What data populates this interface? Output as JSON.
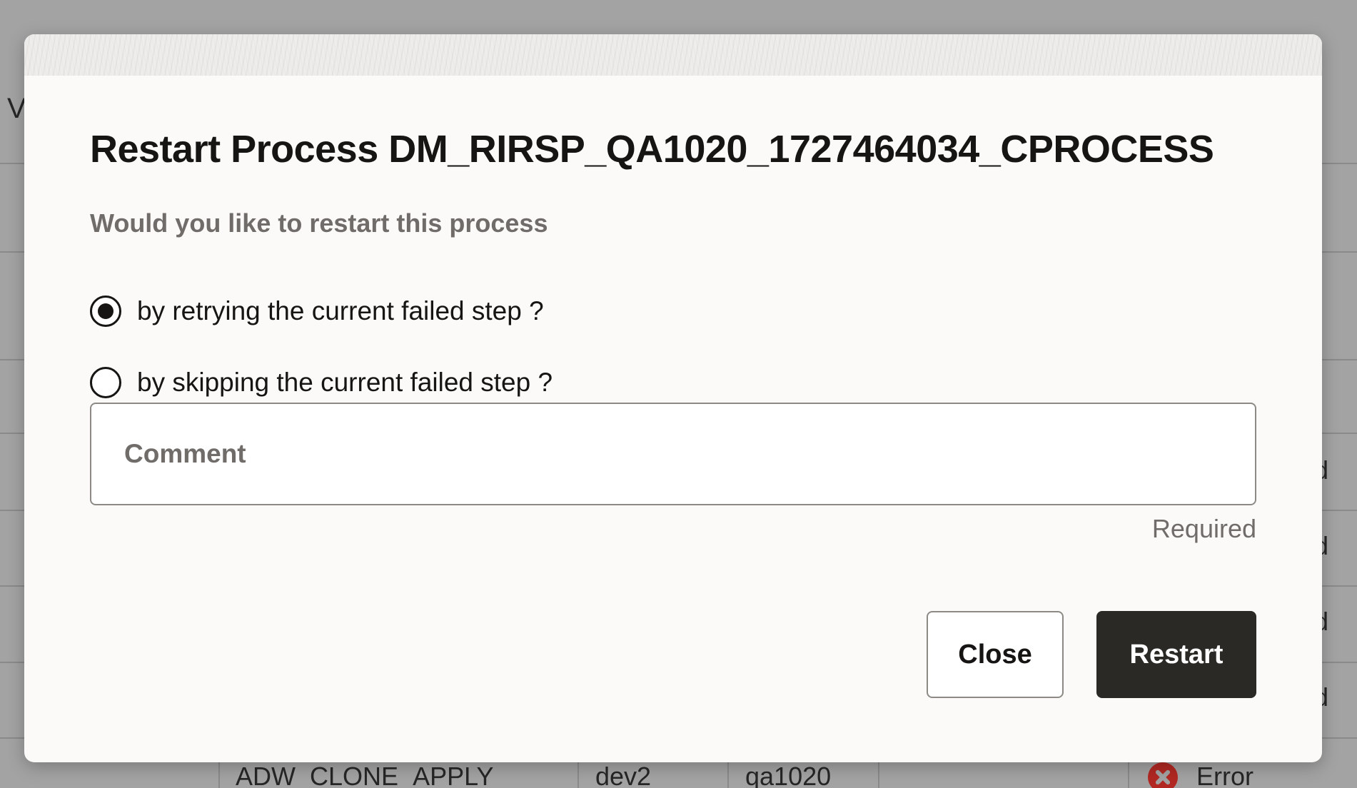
{
  "background": {
    "edge_char": "V",
    "status_tails": [
      "d",
      "d",
      "d",
      "d"
    ],
    "row": {
      "name": "ADW_CLONE_APPLY",
      "env": "dev2",
      "pod": "qa1020",
      "status": "Error",
      "status_color": "#b22822"
    }
  },
  "dialog": {
    "title": "Restart Process DM_RIRSP_QA1020_1727464034_CPROCESS",
    "prompt": "Would you like to restart this process",
    "options": [
      {
        "label": "by retrying the current failed step ?",
        "selected": true
      },
      {
        "label": "by skipping the current failed step ?",
        "selected": false
      }
    ],
    "comment": {
      "placeholder": "Comment",
      "value": ""
    },
    "required_hint": "Required",
    "buttons": {
      "close": "Close",
      "restart": "Restart"
    }
  },
  "colors": {
    "overlay": "#a3a3a3",
    "dialog_bg": "#fcfaf9",
    "primary_button": "#2b2926",
    "text": "#161513",
    "muted_text": "#6f6c69"
  },
  "icons": [
    "radio-selected-icon",
    "radio-unselected-icon",
    "error-icon"
  ]
}
